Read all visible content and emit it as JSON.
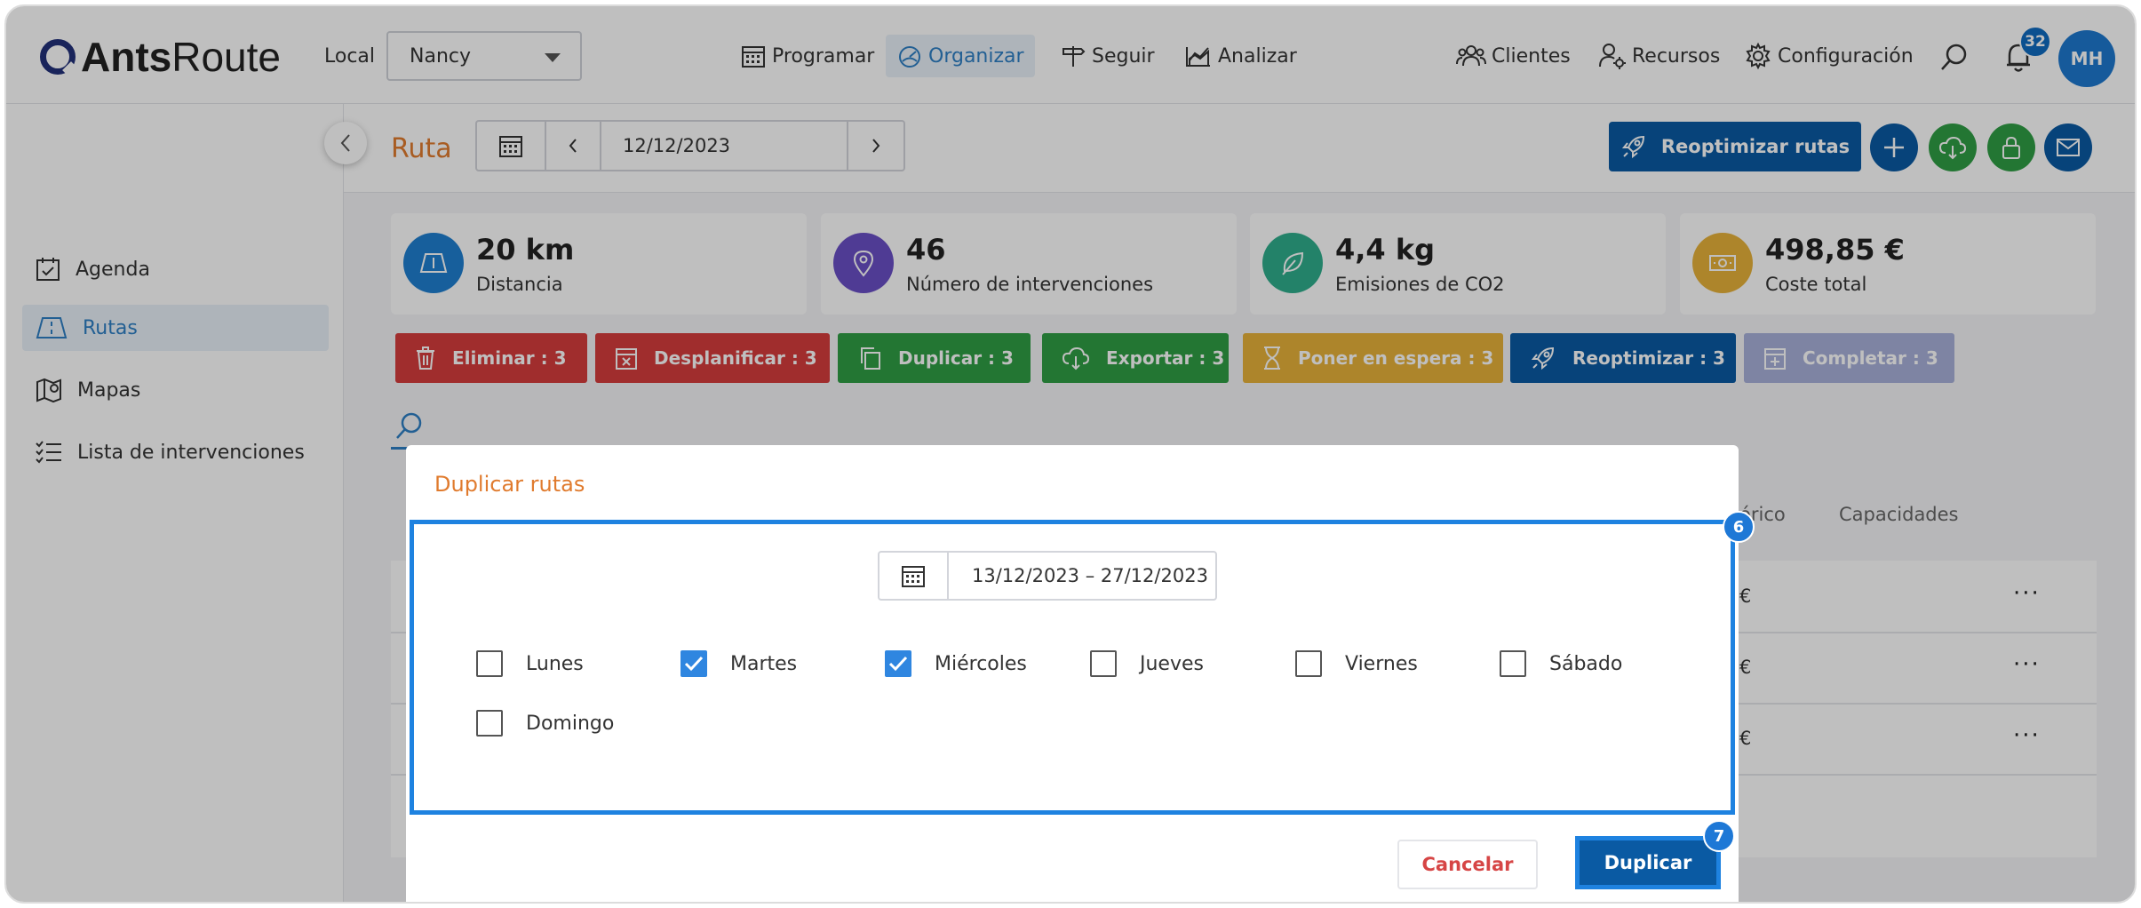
{
  "app": {
    "logo_bold": "Ants",
    "logo_light": "Route"
  },
  "topnav": {
    "local_label": "Local",
    "local_value": "Nancy",
    "items": [
      {
        "label": "Programar",
        "icon": "calendar-icon"
      },
      {
        "label": "Organizar",
        "icon": "gauge-icon",
        "active": true
      },
      {
        "label": "Seguir",
        "icon": "signpost-icon"
      },
      {
        "label": "Analizar",
        "icon": "chart-icon"
      }
    ],
    "right_items": [
      {
        "label": "Clientes",
        "icon": "users-icon"
      },
      {
        "label": "Recursos",
        "icon": "user-gear-icon"
      },
      {
        "label": "Configuración",
        "icon": "gear-icon"
      }
    ],
    "notifications": "32",
    "avatar_initials": "MH"
  },
  "sidebar": {
    "items": [
      {
        "label": "Agenda",
        "icon": "agenda-icon"
      },
      {
        "label": "Rutas",
        "icon": "route-icon",
        "active": true
      },
      {
        "label": "Mapas",
        "icon": "map-icon"
      },
      {
        "label": "Lista de intervenciones",
        "icon": "list-icon"
      }
    ]
  },
  "header": {
    "title": "Ruta",
    "date": "12/12/2023",
    "reoptimize_label": "Reoptimizar rutas"
  },
  "stats": [
    {
      "value": "20 km",
      "label": "Distancia",
      "color": "#1f7fd1",
      "icon": "map-book-icon"
    },
    {
      "value": "46",
      "label": "Número de intervenciones",
      "color": "#6a4fc6",
      "icon": "pin-icon"
    },
    {
      "value": "4,4 kg",
      "label": "Emisiones de CO2",
      "color": "#2fae8c",
      "icon": "leaf-icon"
    },
    {
      "value": "498,85 €",
      "label": "Coste total",
      "color": "#e7b23a",
      "icon": "money-icon"
    }
  ],
  "actions": [
    {
      "label": "Eliminar : 3",
      "color": "#d63c3c",
      "icon": "trash-icon"
    },
    {
      "label": "Desplanificar : 3",
      "color": "#d63c3c",
      "icon": "unplan-icon"
    },
    {
      "label": "Duplicar : 3",
      "color": "#2f9e44",
      "icon": "copy-icon"
    },
    {
      "label": "Exportar : 3",
      "color": "#2f9e44",
      "icon": "cloud-download-icon"
    },
    {
      "label": "Poner en espera : 3",
      "color": "#e7b23a",
      "icon": "hourglass-icon"
    },
    {
      "label": "Reoptimizar : 3",
      "color": "#0a5aa3",
      "icon": "rocket-icon"
    },
    {
      "label": "Completar : 3",
      "color": "#a9b1da",
      "icon": "complete-icon"
    }
  ],
  "table": {
    "headers_visible": [
      "órico",
      "Capacidades"
    ],
    "rows": [
      {
        "fragment": "€"
      },
      {
        "fragment": "€"
      },
      {
        "fragment": "€"
      }
    ]
  },
  "modal": {
    "title": "Duplicar rutas",
    "date_range": "13/12/2023 – 27/12/2023",
    "days": [
      {
        "label": "Lunes",
        "checked": false
      },
      {
        "label": "Martes",
        "checked": true
      },
      {
        "label": "Miércoles",
        "checked": true
      },
      {
        "label": "Jueves",
        "checked": false
      },
      {
        "label": "Viernes",
        "checked": false
      },
      {
        "label": "Sábado",
        "checked": false
      },
      {
        "label": "Domingo",
        "checked": false
      }
    ],
    "step_body": "6",
    "step_button": "7",
    "cancel_label": "Cancelar",
    "duplicate_label": "Duplicar"
  }
}
